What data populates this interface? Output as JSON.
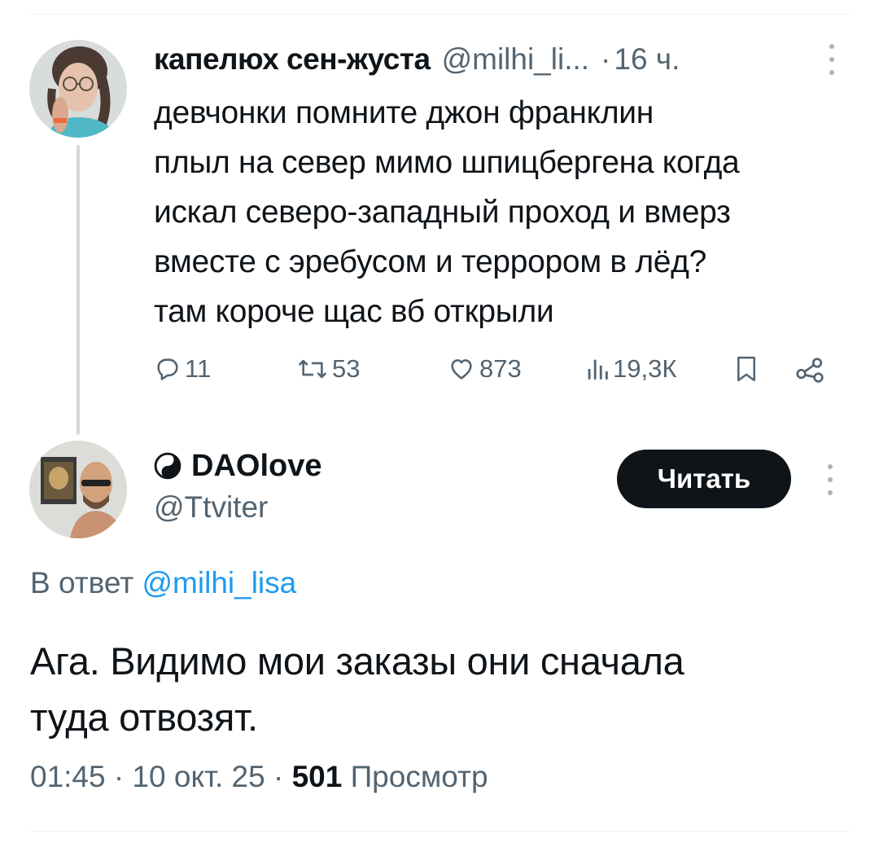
{
  "parent_tweet": {
    "author_name": "капелюх сен-жуста",
    "handle": "@milhi_li...",
    "separator": "·",
    "time": "16 ч.",
    "text": "девчонки помните джон франклин\nплыл на север мимо шпицбергена когда\nискал северо-западный проход и вмерз\nвместе с эребусом и террором в лёд?\nтам короче щас вб открыли",
    "actions": {
      "replies": "11",
      "retweets": "53",
      "likes": "873",
      "views": "19,3К"
    }
  },
  "reply_tweet": {
    "author_name": "DAOlove",
    "handle": "@Ttviter",
    "follow_label": "Читать",
    "reply_prefix": "В ответ",
    "reply_mention": "@milhi_lisa",
    "text": "Ага. Видимо мои заказы они сначала\nтуда отвозят.",
    "meta": {
      "time": "01:45",
      "date": "10 окт. 25",
      "separator": "·",
      "views_count": "501",
      "views_label": "Просмотр"
    }
  },
  "icons": {
    "reply": "speech-bubble-icon",
    "retweet": "retweet-arrows-icon",
    "like": "heart-icon",
    "views": "bar-chart-icon",
    "bookmark": "bookmark-icon",
    "share": "share-nodes-icon",
    "author_badge": "yin-yang-icon",
    "more": "vertical-dots-icon"
  },
  "colors": {
    "text": "#0f1419",
    "secondary": "#536471",
    "link": "#1d9bf0",
    "button_bg": "#0f1419",
    "thread_line": "#cfd9de"
  }
}
